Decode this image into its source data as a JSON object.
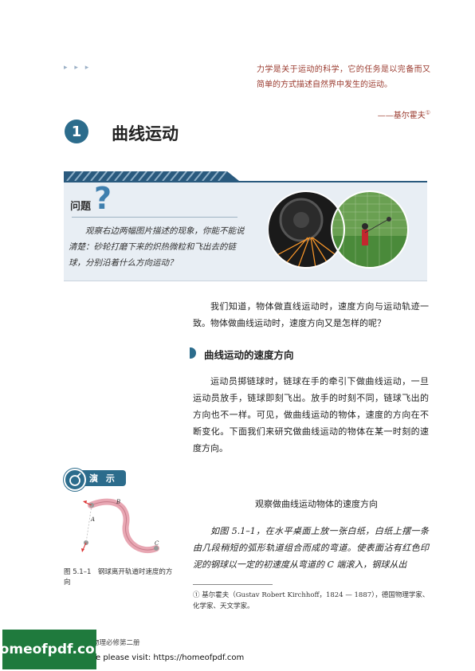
{
  "header": {
    "arrows": "▸ ▸ ▸",
    "quote": "力学是关于运动的科学，它的任务是以完备而又简单的方式描述自然界中发生的运动。",
    "quote_author": "——基尔霍夫",
    "quote_author_ref": "①"
  },
  "section": {
    "number": "1",
    "title": "曲线运动"
  },
  "problem": {
    "title": "问题",
    "icon_mark": "?",
    "text": "观察右边两幅图片描述的现象，你能不能说清楚：砂轮打磨下来的炽热微粒和飞出去的链球，分别沿着什么方向运动？"
  },
  "intro": "我们知道，物体做直线运动时，速度方向与运动轨迹一致。物体做曲线运动时，速度方向又是怎样的呢？",
  "subsection": {
    "title": "曲线运动的速度方向",
    "text": "运动员掷链球时，链球在手的牵引下做曲线运动，一旦运动员放手，链球即刻飞出。放手的时刻不同，链球飞出的方向也不一样。可见，做曲线运动的物体，速度的方向在不断变化。下面我们来研究做曲线运动的物体在某一时刻的速度方向。"
  },
  "demo": {
    "label": "演 示",
    "title": "观察做曲线运动物体的速度方向",
    "text": "如图 5.1–1，在水平桌面上放一张白纸，白纸上摆一条由几段稍短的弧形轨道组合而成的弯道。使表面沾有红色印泥的钢球以一定的初速度从弯道的 C 端滚入，钢球从出",
    "figure_labels": {
      "a": "A",
      "b": "B",
      "c": "C"
    },
    "figure_caption": "图 5.1–1　钢球离开轨道时速度的方向"
  },
  "footnote": "① 基尔霍夫（Gustav Robert Kirchhoff，1824 — 1887），德国物理学家、化学家、天文学家。",
  "footer": {
    "book_title": "物理必修第二册",
    "brand": "homeofpdf.com",
    "visit_text": "e please visit: https://homeofpdf.com"
  },
  "colors": {
    "accent": "#2c6c8c",
    "quote": "#9a3a2e",
    "box": "#e8eef4",
    "brand": "#1f7a3d"
  }
}
